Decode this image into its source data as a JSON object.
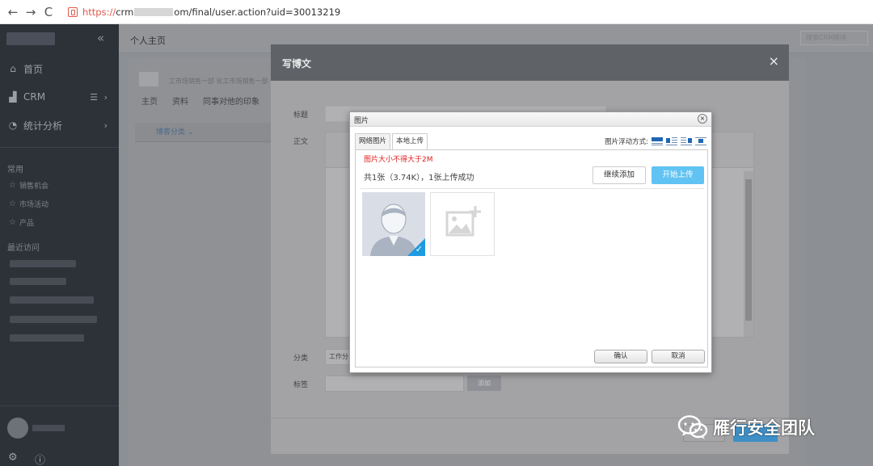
{
  "browser": {
    "back": "←",
    "forward": "→",
    "reload": "C",
    "url_scheme": "https://",
    "url_host_start": "crm",
    "url_host_end": "om/final/user.action?uid=30013219"
  },
  "sidebar": {
    "collapse": "«",
    "items": [
      {
        "icon": "home-icon",
        "label": "首页"
      },
      {
        "icon": "bar-chart-icon",
        "label": "CRM"
      },
      {
        "icon": "pie-chart-icon",
        "label": "统计分析"
      }
    ],
    "common_heading": "常用",
    "common_items": [
      "销售机会",
      "市场活动",
      "产品"
    ],
    "recent_heading": "最近访问"
  },
  "main": {
    "title": "个人主页",
    "search_placeholder": "搜索CRM模块",
    "profile_text": "工市场销售一部 化工市场销售一部",
    "tabs": [
      "主页",
      "资料",
      "同事对他的印象"
    ],
    "blog_category": "博客分类"
  },
  "blog_modal": {
    "title": "写博文",
    "close": "×",
    "labels": {
      "title": "标题",
      "body": "正文",
      "category": "分类",
      "tags": "标签"
    },
    "category_value": "工作分",
    "tag_add": "添加"
  },
  "image_dialog": {
    "title": "图片",
    "close": "×",
    "tabs": [
      "网络图片",
      "本地上传"
    ],
    "float_label": "图片浮动方式:",
    "size_note": "图片大小不得大于2M",
    "upload_info": "共1张（3.74K），1张上传成功",
    "continue_add": "继续添加",
    "start_upload": "开始上传",
    "ok": "确认",
    "cancel": "取消"
  },
  "watermark": {
    "text": "雁行安全团队"
  },
  "colors": {
    "sidebar_bg": "#2d3239",
    "accent_blue": "#61c3f3",
    "warning_red": "#e02020",
    "check_blue": "#1f9ae0"
  }
}
